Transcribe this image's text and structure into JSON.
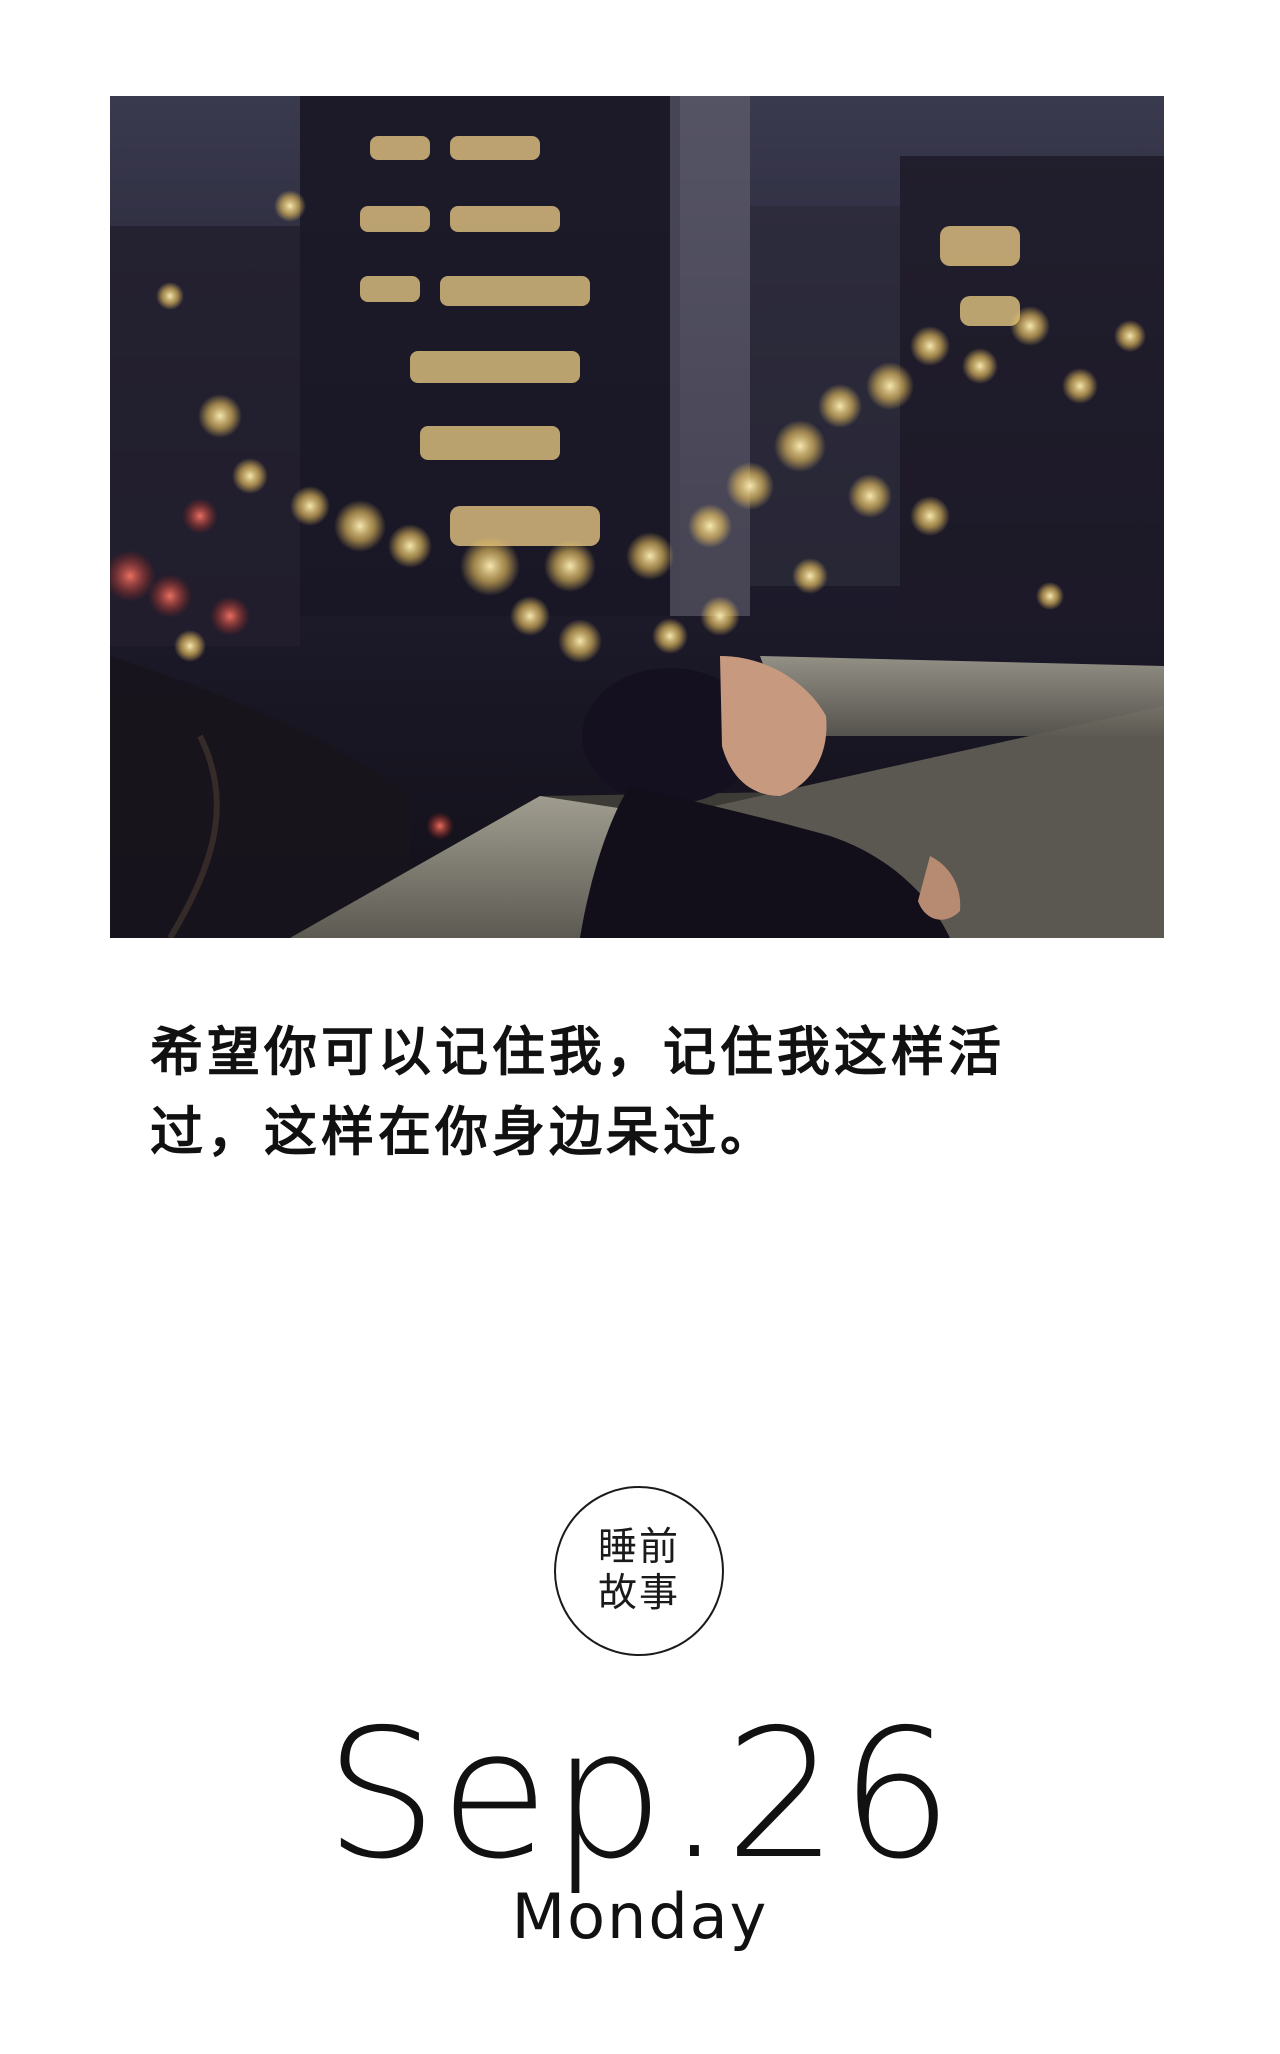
{
  "photo": {
    "icon": "night-city-portrait-photo",
    "colors": {
      "sky": "#2a2a3d",
      "lights": "#f2d27a",
      "wall": "#8c8a7e",
      "shadow": "#141222"
    }
  },
  "quote": {
    "line1": "希望你可以记住我，记住我这样活",
    "line2": "过，这样在你身边呆过。"
  },
  "badge": {
    "line1": "睡前",
    "line2": "故事"
  },
  "date": {
    "text": "Sep.26",
    "weekday": "Monday"
  }
}
